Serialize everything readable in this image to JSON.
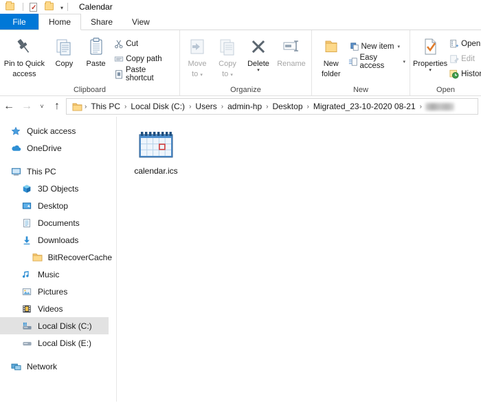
{
  "titlebar": {
    "title": "Calendar",
    "qat": [
      {
        "name": "folder-icon",
        "label": "Folder"
      },
      {
        "name": "properties-icon",
        "label": "Properties"
      },
      {
        "name": "new-folder-icon",
        "label": "New folder"
      }
    ],
    "customize_caret": "▾"
  },
  "tabs": [
    {
      "id": "file",
      "label": "File"
    },
    {
      "id": "home",
      "label": "Home"
    },
    {
      "id": "share",
      "label": "Share"
    },
    {
      "id": "view",
      "label": "View"
    }
  ],
  "ribbon": {
    "groups": [
      {
        "id": "clipboard",
        "label": "Clipboard",
        "big": [
          {
            "id": "pin-to-quick-access",
            "line1": "Pin to Quick",
            "line2": "access",
            "icon": "pin-icon",
            "disabled": false
          },
          {
            "id": "copy",
            "line1": "Copy",
            "line2": "",
            "icon": "copy-icon",
            "disabled": false
          },
          {
            "id": "paste",
            "line1": "Paste",
            "line2": "",
            "icon": "paste-icon",
            "disabled": false
          }
        ],
        "small": [
          {
            "id": "cut",
            "label": "Cut",
            "icon": "scissors-icon",
            "disabled": false
          },
          {
            "id": "copy-path",
            "label": "Copy path",
            "icon": "copy-path-icon",
            "disabled": false
          },
          {
            "id": "paste-shortcut",
            "label": "Paste shortcut",
            "icon": "paste-shortcut-icon",
            "disabled": false
          }
        ]
      },
      {
        "id": "organize",
        "label": "Organize",
        "big": [
          {
            "id": "move-to",
            "line1": "Move",
            "line2": "to",
            "icon": "move-to-icon",
            "disabled": true,
            "caret": true
          },
          {
            "id": "copy-to",
            "line1": "Copy",
            "line2": "to",
            "icon": "copy-to-icon",
            "disabled": true,
            "caret": true
          },
          {
            "id": "delete",
            "line1": "Delete",
            "line2": "",
            "icon": "delete-icon",
            "disabled": false,
            "caret": true
          },
          {
            "id": "rename",
            "line1": "Rename",
            "line2": "",
            "icon": "rename-icon",
            "disabled": true
          }
        ]
      },
      {
        "id": "new",
        "label": "New",
        "big": [
          {
            "id": "new-folder",
            "line1": "New",
            "line2": "folder",
            "icon": "new-folder-icon",
            "disabled": false
          }
        ],
        "small": [
          {
            "id": "new-item",
            "label": "New item",
            "icon": "new-item-icon",
            "caret": "▾",
            "disabled": false
          },
          {
            "id": "easy-access",
            "label": "Easy access",
            "icon": "easy-access-icon",
            "caret": "▾",
            "disabled": false
          }
        ]
      },
      {
        "id": "open",
        "label": "Open",
        "big": [
          {
            "id": "properties",
            "line1": "Properties",
            "line2": "",
            "icon": "properties-icon",
            "disabled": false,
            "caret": true
          }
        ],
        "small": [
          {
            "id": "open",
            "label": "Open",
            "icon": "open-icon",
            "disabled": false
          },
          {
            "id": "edit",
            "label": "Edit",
            "icon": "edit-icon",
            "disabled": true
          },
          {
            "id": "history",
            "label": "History",
            "icon": "history-icon",
            "disabled": false
          }
        ]
      }
    ]
  },
  "address": {
    "back": "←",
    "forward": "→",
    "recent": "˅",
    "up": "↑",
    "separator": "›",
    "crumbs": [
      "This PC",
      "Local Disk (C:)",
      "Users",
      "admin-hp",
      "Desktop",
      "Migrated_23-10-2020 08-21"
    ],
    "redacted_crumb": ""
  },
  "sidebar": {
    "items": [
      {
        "id": "quick-access",
        "label": "Quick access",
        "icon": "star-icon",
        "indent": 0,
        "selected": false
      },
      {
        "id": "onedrive",
        "label": "OneDrive",
        "icon": "cloud-icon",
        "indent": 0,
        "selected": false
      },
      {
        "id": "this-pc",
        "label": "This PC",
        "icon": "monitor-icon",
        "indent": 0,
        "selected": false
      },
      {
        "id": "3d-objects",
        "label": "3D Objects",
        "icon": "cube-icon",
        "indent": 1,
        "selected": false
      },
      {
        "id": "desktop",
        "label": "Desktop",
        "icon": "desktop-icon",
        "indent": 1,
        "selected": false
      },
      {
        "id": "documents",
        "label": "Documents",
        "icon": "documents-icon",
        "indent": 1,
        "selected": false
      },
      {
        "id": "downloads",
        "label": "Downloads",
        "icon": "download-arrow-icon",
        "indent": 1,
        "selected": false
      },
      {
        "id": "bitrecovercache",
        "label": "BitRecoverCache",
        "icon": "folder-icon",
        "indent": 2,
        "selected": false
      },
      {
        "id": "music",
        "label": "Music",
        "icon": "music-note-icon",
        "indent": 1,
        "selected": false
      },
      {
        "id": "pictures",
        "label": "Pictures",
        "icon": "picture-icon",
        "indent": 1,
        "selected": false
      },
      {
        "id": "videos",
        "label": "Videos",
        "icon": "video-icon",
        "indent": 1,
        "selected": false
      },
      {
        "id": "local-disk-c",
        "label": "Local Disk (C:)",
        "icon": "drive-icon",
        "indent": 1,
        "selected": true
      },
      {
        "id": "local-disk-e",
        "label": "Local Disk (E:)",
        "icon": "drive-plain-icon",
        "indent": 1,
        "selected": false
      },
      {
        "id": "network",
        "label": "Network",
        "icon": "network-icon",
        "indent": 0,
        "selected": false
      }
    ]
  },
  "content": {
    "files": [
      {
        "id": "calendar-ics",
        "name": "calendar.ics",
        "icon": "calendar-file-icon"
      }
    ]
  },
  "colors": {
    "accent": "#0078d7",
    "selection": "#e2e2e2",
    "folder": "#fdd98a",
    "calendar_blue": "#2f6fb5",
    "calendar_red": "#d23b3b"
  }
}
